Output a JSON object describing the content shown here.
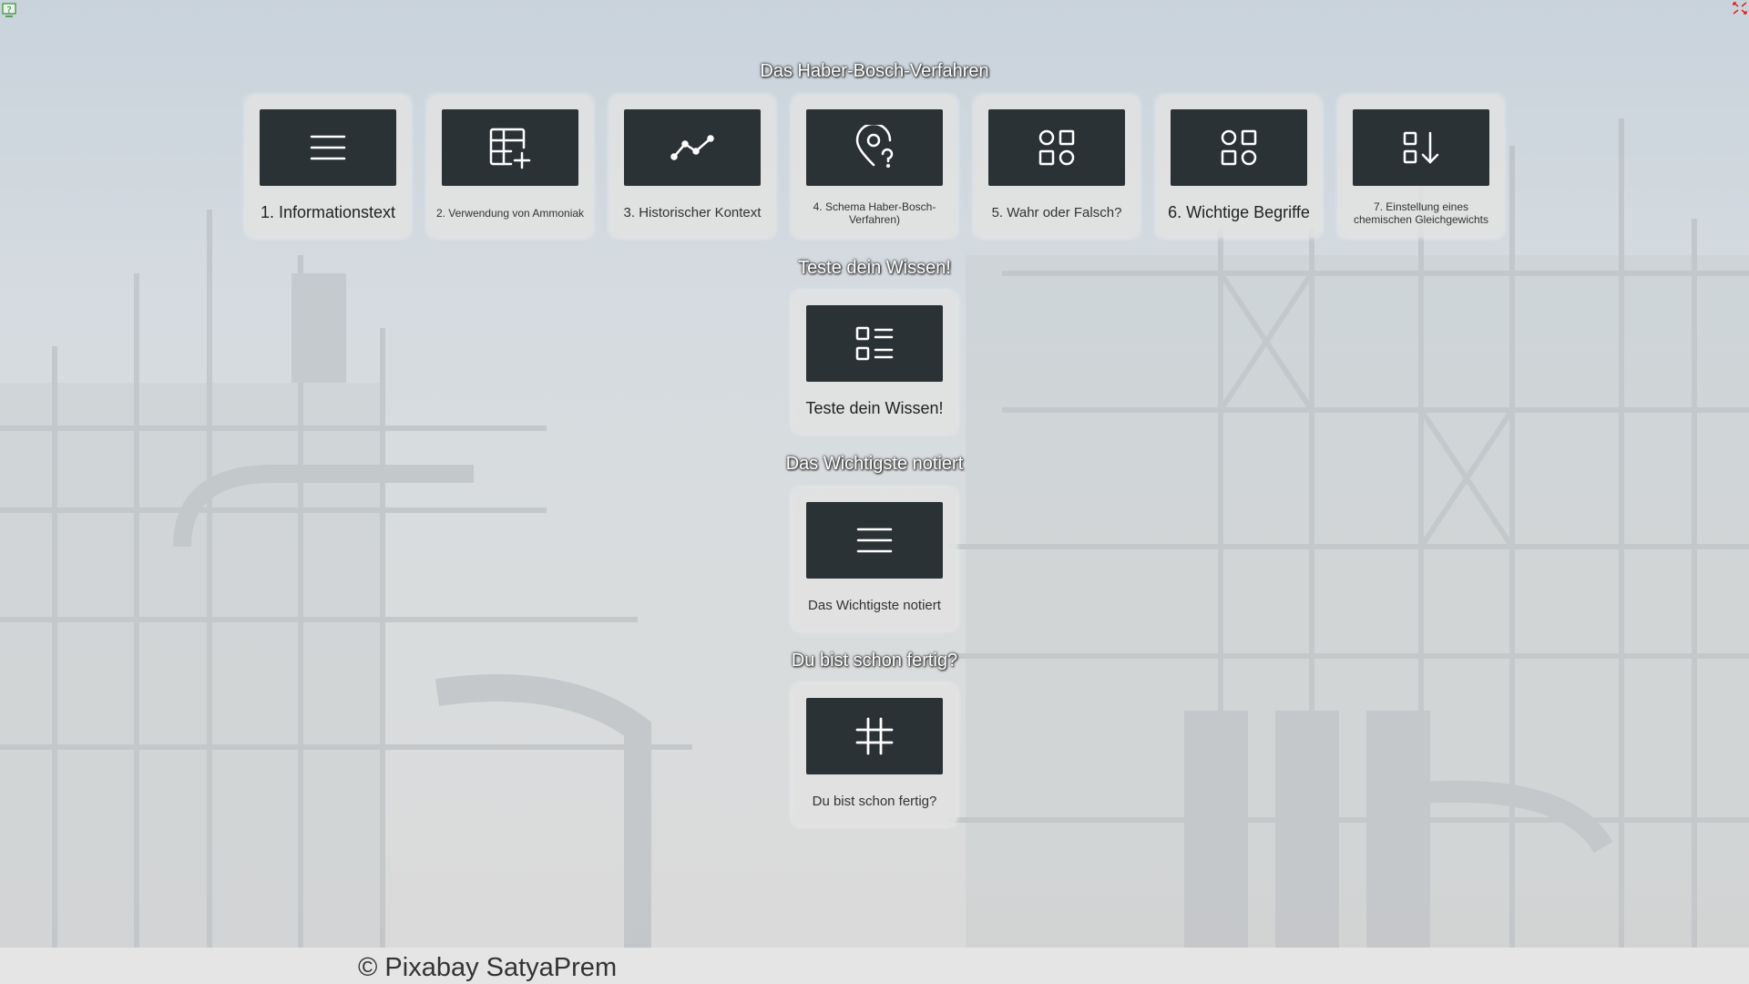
{
  "header": {
    "title": "Das Haber-Bosch-Verfahren"
  },
  "modules": [
    {
      "label": "1. Informationstext",
      "icon": "text-lines-icon"
    },
    {
      "label": "2. Verwendung von Ammoniak",
      "icon": "table-add-icon"
    },
    {
      "label": "3. Historischer Kontext",
      "icon": "timeline-icon"
    },
    {
      "label": "4. Schema Haber-Bosch-Verfahren)",
      "icon": "map-pin-question-icon"
    },
    {
      "label": "5. Wahr oder Falsch?",
      "icon": "grid-shapes-icon"
    },
    {
      "label": "6. Wichtige Begriffe",
      "icon": "grid-shapes-icon"
    },
    {
      "label": "7. Einstellung eines chemischen Gleichgewichts",
      "icon": "sort-down-icon"
    }
  ],
  "quiz_section": {
    "title": "Teste dein Wissen!",
    "tile_label": "Teste dein Wissen!",
    "icon": "checklist-icon"
  },
  "summary_section": {
    "title": "Das Wichtigste notiert",
    "tile_label": "Das Wichtigste notiert",
    "icon": "text-lines-icon"
  },
  "finished_section": {
    "title": "Du bist schon fertig?",
    "tile_label": "Du bist schon fertig?",
    "icon": "hashtag-icon"
  },
  "footer": {
    "credit": "© Pixabay SatyaPrem"
  },
  "colors": {
    "icon_box": "#2b3236",
    "tile_bg": "#e1e1e1",
    "title_text": "#ffffff"
  }
}
